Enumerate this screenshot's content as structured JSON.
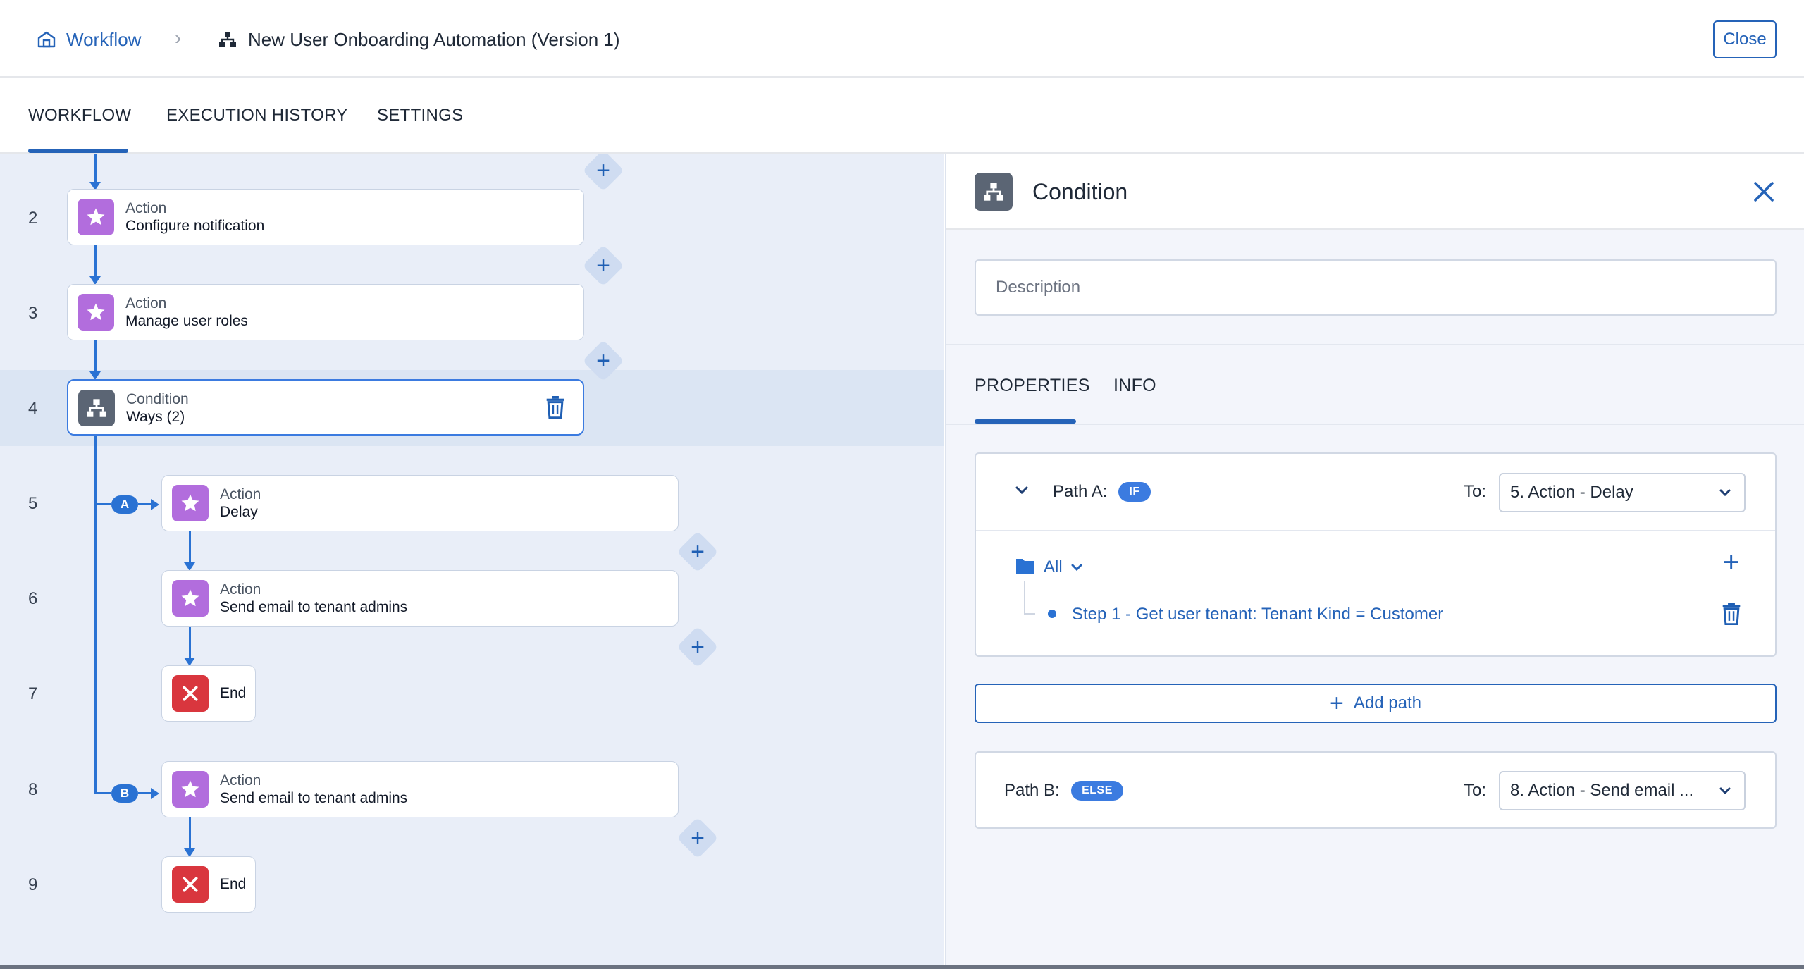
{
  "header": {
    "breadcrumb_root": "Workflow",
    "breadcrumb_current": "New User Onboarding Automation (Version 1)",
    "close_label": "Close"
  },
  "tabs": [
    {
      "label": "WORKFLOW",
      "active": true
    },
    {
      "label": "EXECUTION HISTORY",
      "active": false
    },
    {
      "label": "SETTINGS",
      "active": false
    }
  ],
  "steps": [
    {
      "num": "2",
      "type": "Action",
      "name": "Configure notification"
    },
    {
      "num": "3",
      "type": "Action",
      "name": "Manage user roles"
    },
    {
      "num": "4",
      "type": "Condition",
      "name": "Ways (2)",
      "selected": true
    },
    {
      "num": "5",
      "type": "Action",
      "name": "Delay",
      "path": "A"
    },
    {
      "num": "6",
      "type": "Action",
      "name": "Send email to tenant admins"
    },
    {
      "num": "7",
      "type": "End",
      "name": "End"
    },
    {
      "num": "8",
      "type": "Action",
      "name": "Send email to tenant admins",
      "path": "B"
    },
    {
      "num": "9",
      "type": "End",
      "name": "End"
    }
  ],
  "panel": {
    "title": "Condition",
    "description_placeholder": "Description",
    "tabs": [
      {
        "label": "PROPERTIES",
        "active": true
      },
      {
        "label": "INFO",
        "active": false
      }
    ],
    "path_a": {
      "label": "Path A:",
      "badge": "IF",
      "to_label": "To:",
      "target": "5. Action - Delay",
      "group_label": "All",
      "rule": "Step 1 - Get user tenant: Tenant Kind = Customer"
    },
    "add_path_label": "Add path",
    "path_b": {
      "label": "Path B:",
      "badge": "ELSE",
      "to_label": "To:",
      "target": "8. Action - Send email ..."
    }
  },
  "colors": {
    "accent": "#2563b8",
    "action_icon": "#b26ddd",
    "condition_icon": "#5b6574",
    "end_icon": "#d9363e",
    "canvas_bg": "#e9eef8"
  }
}
